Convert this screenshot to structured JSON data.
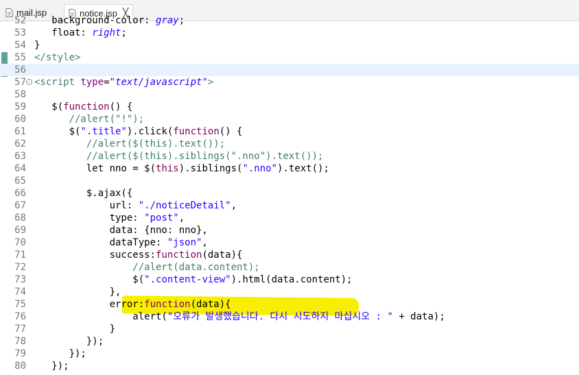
{
  "tabs": [
    {
      "label": "mail.jsp",
      "active": false,
      "icon": "jsp-file-icon"
    },
    {
      "label": "notice.jsp",
      "active": true,
      "icon": "jsp-file-icon",
      "close": "╳"
    }
  ],
  "colors": {
    "keyword": "#7f0055",
    "string": "#2a00ff",
    "comment": "#3f7f5f",
    "highlight": "#f7ee00",
    "current_line": "#e8f2fe"
  },
  "editor": {
    "current_line": 56,
    "lines": [
      {
        "n": "52",
        "t": "   background-color: gray;"
      },
      {
        "n": "53",
        "t": "   float: right;"
      },
      {
        "n": "54",
        "t": "}"
      },
      {
        "n": "55",
        "t": "</style>"
      },
      {
        "n": "56",
        "t": ""
      },
      {
        "n": "57",
        "t": "<script type=\"text/javascript\">"
      },
      {
        "n": "58",
        "t": ""
      },
      {
        "n": "59",
        "t": "   $(function() {"
      },
      {
        "n": "60",
        "t": "      //alert(\"!\");"
      },
      {
        "n": "61",
        "t": "      $(\".title\").click(function() {"
      },
      {
        "n": "62",
        "t": "         //alert($(this).text());"
      },
      {
        "n": "63",
        "t": "         //alert($(this).siblings(\".nno\").text());"
      },
      {
        "n": "64",
        "t": "         let nno = $(this).siblings(\".nno\").text();"
      },
      {
        "n": "65",
        "t": ""
      },
      {
        "n": "66",
        "t": "         $.ajax({"
      },
      {
        "n": "67",
        "t": "             url: \"./noticeDetail\","
      },
      {
        "n": "68",
        "t": "             type: \"post\","
      },
      {
        "n": "69",
        "t": "             data: {nno: nno},"
      },
      {
        "n": "70",
        "t": "             dataType: \"json\","
      },
      {
        "n": "71",
        "t": "             success:function(data){"
      },
      {
        "n": "72",
        "t": "                 //alert(data.content);"
      },
      {
        "n": "73",
        "t": "                 $(\".content-view\").html(data.content);"
      },
      {
        "n": "74",
        "t": "             },"
      },
      {
        "n": "75",
        "t": "             error:function(data){"
      },
      {
        "n": "76",
        "t": "                 alert(\"오류가 발생했습니다. 다시 시도하지 마십시오 : \" + data);"
      },
      {
        "n": "77",
        "t": "             }"
      },
      {
        "n": "78",
        "t": "         });"
      },
      {
        "n": "79",
        "t": "      });"
      },
      {
        "n": "80",
        "t": "   });"
      }
    ]
  }
}
